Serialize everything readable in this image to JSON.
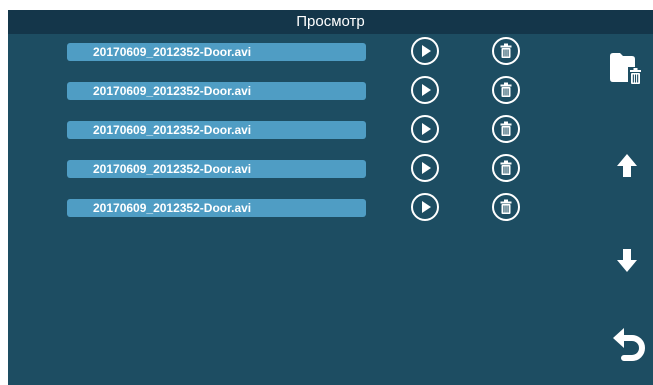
{
  "header": {
    "title": "Просмотр"
  },
  "files": [
    {
      "name": "20170609_2012352-Door.avi"
    },
    {
      "name": "20170609_2012352-Door.avi"
    },
    {
      "name": "20170609_2012352-Door.avi"
    },
    {
      "name": "20170609_2012352-Door.avi"
    },
    {
      "name": "20170609_2012352-Door.avi"
    }
  ],
  "icons": {
    "play": "play-icon",
    "delete": "trash-icon",
    "delete_all": "folder-trash-icon",
    "up": "arrow-up-icon",
    "down": "arrow-down-icon",
    "back": "back-arrow-icon"
  },
  "colors": {
    "screen_bg": "#1d4d62",
    "titlebar_bg": "#14364a",
    "file_button_bg": "#4f9dc4",
    "icon": "#ffffff"
  }
}
